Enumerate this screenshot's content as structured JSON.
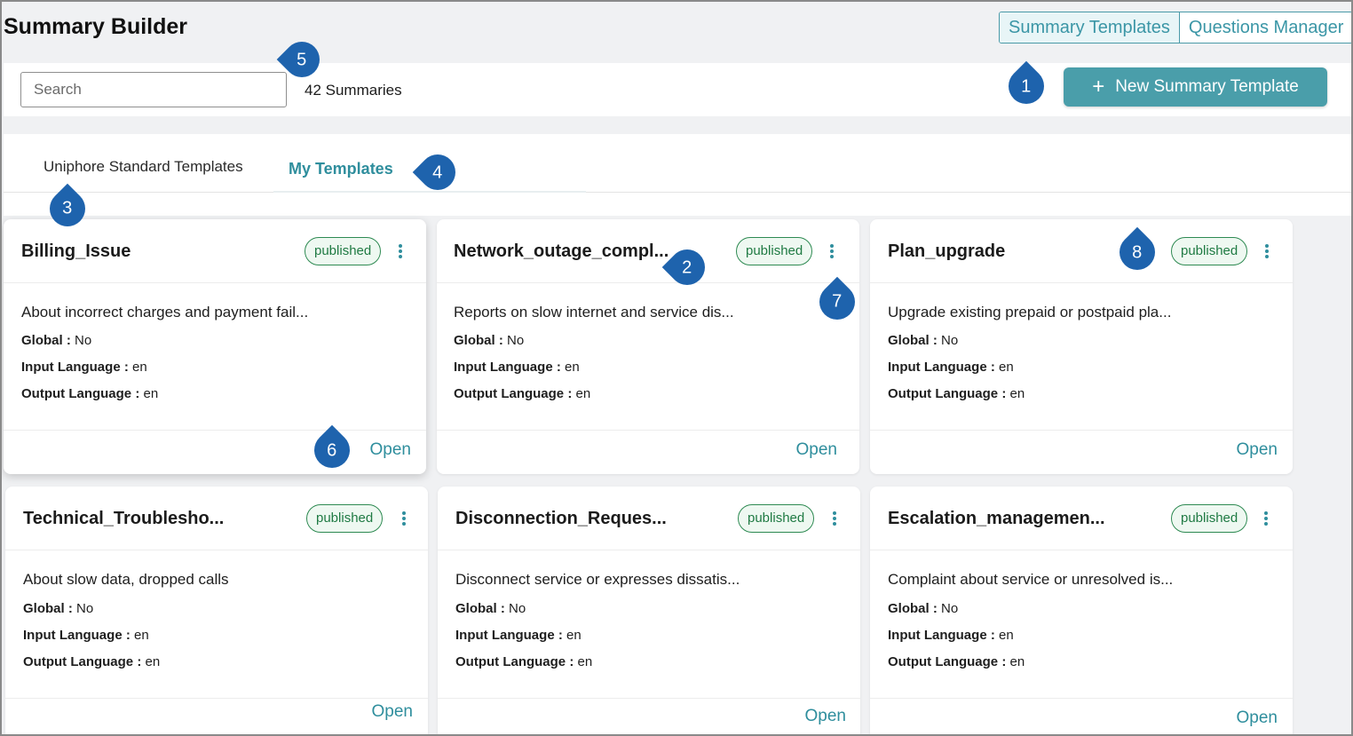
{
  "header": {
    "title": "Summary Builder",
    "nav_tabs": [
      {
        "label": "Summary Templates"
      },
      {
        "label": "Questions Manager"
      }
    ]
  },
  "toolbar": {
    "search_placeholder": "Search",
    "count_label": "42 Summaries",
    "new_button_icon": "plus-icon",
    "new_button_label": "New Summary Template"
  },
  "tabs": [
    {
      "label": "Uniphore Standard Templates"
    },
    {
      "label": "My Templates"
    }
  ],
  "card_labels": {
    "global": "Global :",
    "input_language": "Input Language :",
    "output_language": "Output Language :",
    "open": "Open"
  },
  "cards": [
    {
      "title": "Billing_Issue",
      "status": "published",
      "description": "About incorrect charges and payment fail...",
      "global": "No",
      "input_language": "en",
      "output_language": "en"
    },
    {
      "title": "Network_outage_compl...",
      "status": "published",
      "description": "Reports on slow internet and service dis...",
      "global": "No",
      "input_language": "en",
      "output_language": "en"
    },
    {
      "title": "Plan_upgrade",
      "status": "published",
      "description": "Upgrade existing prepaid or postpaid pla...",
      "global": "No",
      "input_language": "en",
      "output_language": "en"
    },
    {
      "title": "Technical_Troublesho...",
      "status": "published",
      "description": "About slow data, dropped calls",
      "global": "No",
      "input_language": "en",
      "output_language": "en"
    },
    {
      "title": "Disconnection_Reques...",
      "status": "published",
      "description": "Disconnect service or expresses dissatis...",
      "global": "No",
      "input_language": "en",
      "output_language": "en"
    },
    {
      "title": "Escalation_managemen...",
      "status": "published",
      "description": "Complaint about service or unresolved is...",
      "global": "No",
      "input_language": "en",
      "output_language": "en"
    }
  ],
  "callouts": [
    "1",
    "2",
    "3",
    "4",
    "5",
    "6",
    "7",
    "8"
  ],
  "colors": {
    "accent": "#4a9eaa",
    "link": "#2f8e9d",
    "status_green": "#1f7a43",
    "callout_blue": "#1e63ad"
  }
}
